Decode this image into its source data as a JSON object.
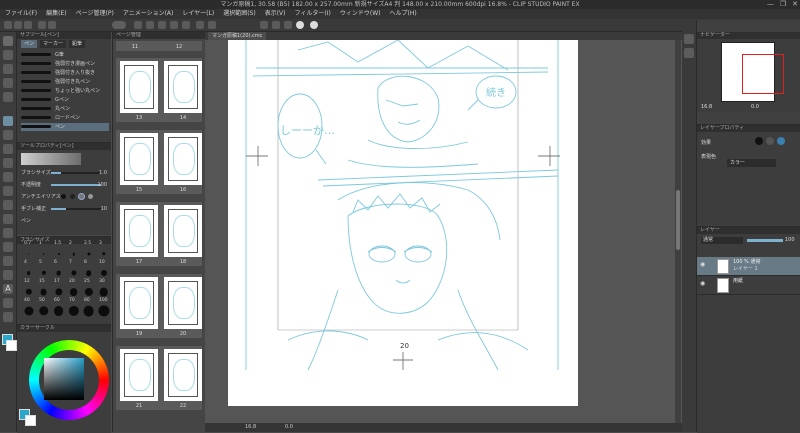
{
  "window": {
    "title": "マンガ原稿1, 30.58 (B5) 182.00 x 257.00mm 新規サイズA4 判 148.00 x 210.00mm 600dpi 16.8% - CLIP STUDIO PAINT EX",
    "controls": [
      "—",
      "❐",
      "✕"
    ]
  },
  "menu": [
    "ファイル(F)",
    "編集(E)",
    "ページ管理(P)",
    "アニメーション(A)",
    "レイヤー(L)",
    "選択範囲(S)",
    "表示(V)",
    "フィルター(I)",
    "ウィンドウ(W)",
    "ヘルプ(H)"
  ],
  "subtool": {
    "header": "サブツール[ペン]",
    "tabs": [
      "ペン",
      "マーカー",
      "鉛筆"
    ],
    "brushes": [
      {
        "label": "G筆",
        "selected": false
      },
      {
        "label": "強弱付き漫画ペン",
        "selected": false
      },
      {
        "label": "強弱付き入り抜き",
        "selected": false
      },
      {
        "label": "強弱付き丸ペン",
        "selected": false
      },
      {
        "label": "ちょっと強い丸ペン",
        "selected": false
      },
      {
        "label": "Gペン",
        "selected": false
      },
      {
        "label": "丸ペン",
        "selected": false
      },
      {
        "label": "ロードペン",
        "selected": false
      },
      {
        "label": "ペン",
        "selected": true
      }
    ]
  },
  "toolprop": {
    "header": "ツールプロパティ[ペン]",
    "rows": [
      {
        "label": "ブラシサイズ",
        "value": "1.0"
      },
      {
        "label": "不透明度",
        "value": "100"
      },
      {
        "label": "アンチエイリアス",
        "value": ""
      },
      {
        "label": "手ブレ補正",
        "value": "10"
      },
      {
        "label": "ペン",
        "value": ""
      }
    ]
  },
  "brushsize": {
    "header": "ブラシサイズ",
    "values": [
      "0.7",
      "1",
      "1.5",
      "2",
      "2.5",
      "3",
      "4",
      "5",
      "6",
      "7",
      "8",
      "10",
      "12",
      "15",
      "17",
      "20",
      "25",
      "30",
      "40",
      "50",
      "60",
      "70",
      "80",
      "100"
    ]
  },
  "colorcircle": {
    "header": "カラーサークル"
  },
  "pagemanager": {
    "header": "ページ管理",
    "pages": [
      "11",
      "12",
      "13",
      "14",
      "15",
      "16",
      "17",
      "18",
      "19",
      "20",
      "21",
      "22"
    ]
  },
  "canvas": {
    "tab": "マンガ原稿1(20).cmc",
    "page_number": "20",
    "balloon_left": "しーーか…",
    "balloon_right": "続き",
    "status_zoom": "16.8",
    "status_angle": "0.0"
  },
  "navigator": {
    "header": "ナビゲーター",
    "zoom": "16.8",
    "angle": "0.0"
  },
  "layerprop": {
    "header": "レイヤープロパティ",
    "effect_label": "効果",
    "expression_label": "表現色",
    "expression_value": "カラー"
  },
  "layer": {
    "header": "レイヤー",
    "blend_mode": "通常",
    "opacity": "100",
    "rows": [
      {
        "name": "100 % 通常",
        "sub": "レイヤー 1",
        "selected": true
      },
      {
        "name": "用紙",
        "sub": "",
        "selected": false
      }
    ]
  },
  "colors": {
    "sketch": "#7cc8dc",
    "main_color": "#2aa7c9",
    "sub_color": "#ffffff",
    "selection": "#677a86"
  }
}
